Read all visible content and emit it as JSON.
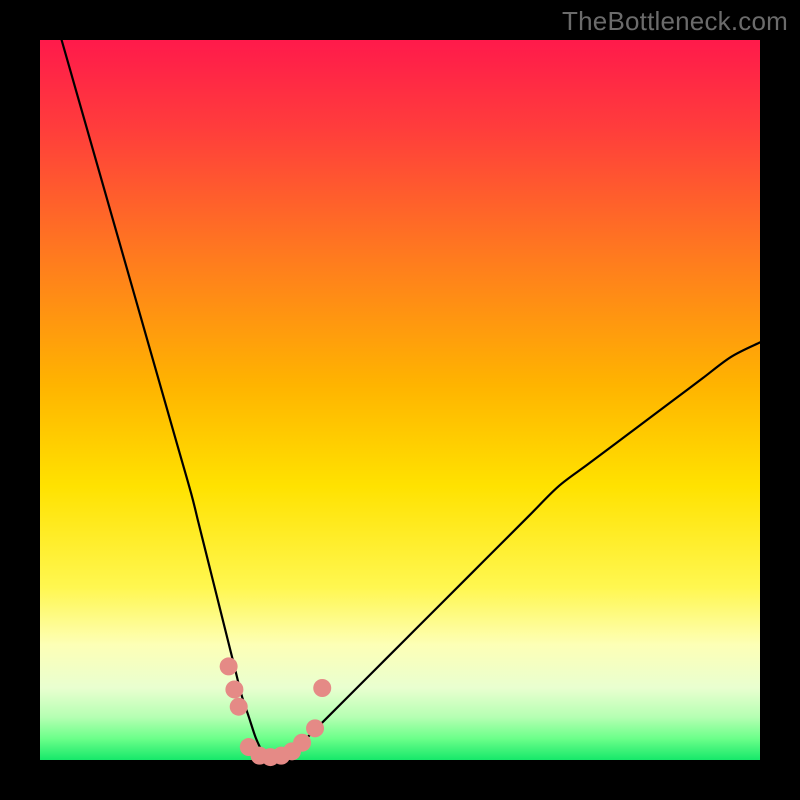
{
  "watermark": {
    "text": "TheBottleneck.com"
  },
  "frame": {
    "outer_w": 800,
    "outer_h": 800,
    "inner_x": 40,
    "inner_y": 40,
    "inner_w": 720,
    "inner_h": 720,
    "border_color": "#000000"
  },
  "gradient": {
    "stops": [
      {
        "pct": 0,
        "color": "#ff1a4b"
      },
      {
        "pct": 12,
        "color": "#ff3c3c"
      },
      {
        "pct": 30,
        "color": "#ff7a1f"
      },
      {
        "pct": 48,
        "color": "#ffb400"
      },
      {
        "pct": 62,
        "color": "#ffe200"
      },
      {
        "pct": 76,
        "color": "#fff750"
      },
      {
        "pct": 84,
        "color": "#fdffb6"
      },
      {
        "pct": 90,
        "color": "#e9ffd0"
      },
      {
        "pct": 94,
        "color": "#b6ffb3"
      },
      {
        "pct": 97,
        "color": "#6cff8a"
      },
      {
        "pct": 100,
        "color": "#16e86a"
      }
    ]
  },
  "chart_data": {
    "type": "line",
    "title": "",
    "xlabel": "",
    "ylabel": "",
    "xlim": [
      0,
      100
    ],
    "ylim": [
      0,
      100
    ],
    "curve": {
      "name": "bottleneck-curve",
      "color": "#000000",
      "width": 2.2,
      "x": [
        3,
        5,
        7,
        9,
        11,
        13,
        15,
        17,
        19,
        21,
        22,
        23,
        24,
        25,
        26,
        27,
        28,
        29,
        30,
        31,
        32,
        33,
        34,
        35,
        37,
        40,
        44,
        48,
        52,
        56,
        60,
        64,
        68,
        72,
        76,
        80,
        84,
        88,
        92,
        96,
        100
      ],
      "y": [
        100,
        93,
        86,
        79,
        72,
        65,
        58,
        51,
        44,
        37,
        33,
        29,
        25,
        21,
        17,
        13,
        9,
        6,
        3,
        1,
        0,
        0,
        0,
        1,
        3,
        6,
        10,
        14,
        18,
        22,
        26,
        30,
        34,
        38,
        41,
        44,
        47,
        50,
        53,
        56,
        58
      ]
    },
    "marker_series": {
      "name": "bottom-markers",
      "color": "#e58a86",
      "radius": 9,
      "points": [
        {
          "x": 26.2,
          "y": 13.0
        },
        {
          "x": 27.0,
          "y": 9.8
        },
        {
          "x": 27.6,
          "y": 7.4
        },
        {
          "x": 29.0,
          "y": 1.8
        },
        {
          "x": 30.5,
          "y": 0.6
        },
        {
          "x": 32.0,
          "y": 0.4
        },
        {
          "x": 33.5,
          "y": 0.6
        },
        {
          "x": 35.0,
          "y": 1.2
        },
        {
          "x": 36.4,
          "y": 2.4
        },
        {
          "x": 38.2,
          "y": 4.4
        },
        {
          "x": 39.2,
          "y": 10.0
        }
      ]
    }
  }
}
